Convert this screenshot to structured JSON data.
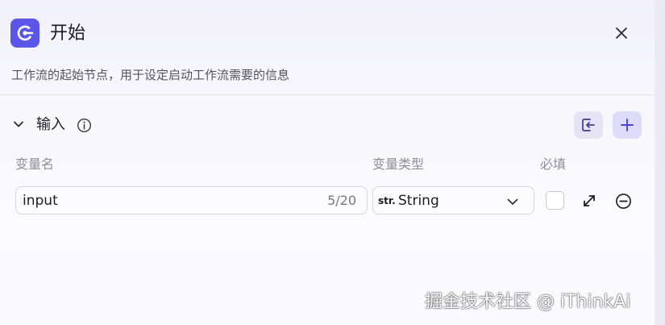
{
  "header": {
    "title": "开始",
    "description": "工作流的起始节点，用于设定启动工作流需要的信息",
    "app_icon": "start-node-icon",
    "close_icon": "close-icon"
  },
  "section": {
    "title": "输入",
    "expanded": true,
    "toggle_icon": "chevron-down-icon",
    "info_icon": "info-icon",
    "import_icon": "import-icon",
    "add_icon": "plus-icon"
  },
  "table": {
    "headers": {
      "name": "变量名",
      "type": "变量类型",
      "required": "必填"
    },
    "rows": [
      {
        "name": "input",
        "char_count": "5/20",
        "type_prefix": "str.",
        "type": "String",
        "required": false
      }
    ]
  },
  "watermark": "掘金技术社区 @ iThinkAi",
  "colors": {
    "accent": "#5b55e8",
    "accent_light": "#dedcf8",
    "text": "#1d1c23",
    "muted": "#8e8d99"
  }
}
